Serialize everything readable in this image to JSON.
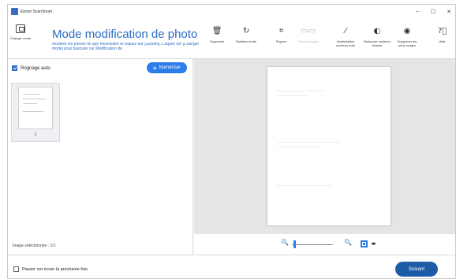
{
  "window": {
    "title": "Epson ScanSmart",
    "controls": [
      "–",
      "☐",
      "✕"
    ]
  },
  "toolbar": {
    "change_mode": "Changer mode",
    "title": "Mode modification de photo",
    "description": "Modifiez les photos tel que nécessaire et cliquez sur [Suivant]. Cliquez sur [Changer mode] pour basculer sur Modification de",
    "tools": [
      {
        "label": "Supprimer",
        "icon": "trash-icon"
      },
      {
        "label": "Rotation droite",
        "icon": "rotate-right-icon"
      },
      {
        "label": "Rogner",
        "icon": "crop-icon"
      },
      {
        "label": "Coudre images",
        "icon": "stitch-images-icon",
        "disabled": true
      },
      {
        "label": "Amélioration couleurs auto",
        "icon": "magic-wand-icon"
      },
      {
        "label": "Restaurer couleurs fanées",
        "icon": "restore-colors-icon"
      },
      {
        "label": "Supprimer les yeux rouges",
        "icon": "eye-icon"
      },
      {
        "label": "Aide",
        "icon": "help-icon"
      }
    ]
  },
  "left": {
    "auto_crop_label": "Rognage auto",
    "auto_crop_checked": true,
    "scan_button": "Numériser",
    "thumbnails": [
      {
        "number": "1"
      }
    ],
    "status": "Image sélectionnée : 1/1"
  },
  "zoom": {
    "out_icon": "zoom-out-icon",
    "in_icon": "zoom-in-icon",
    "level": 0.05
  },
  "footer": {
    "skip_label": "Passer cet écran la prochaine fois.",
    "skip_checked": false,
    "next_button": "Suivant"
  },
  "colors": {
    "accent": "#2b7de9",
    "title": "#2b6cc4",
    "next": "#1f5ca8",
    "preview_bg": "#e5e5e5"
  }
}
